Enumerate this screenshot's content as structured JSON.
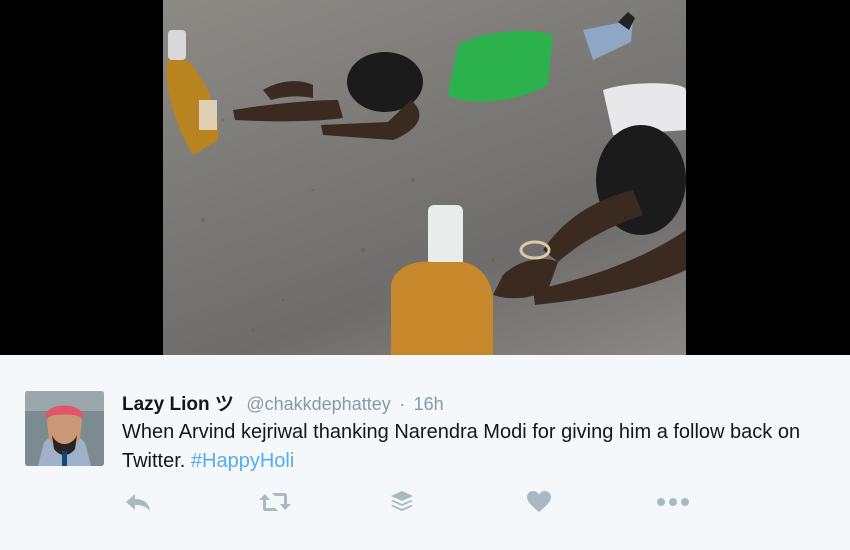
{
  "tweet": {
    "display_name": "Lazy Lion ツ",
    "handle": "@chakkdephattey",
    "separator": "·",
    "time": "16h",
    "text_main": "When Arvind kejriwal thanking Narendra Modi for giving him a follow back on Twitter. ",
    "hashtag": "#HappyHoli"
  },
  "actions": [
    {
      "name": "reply-icon"
    },
    {
      "name": "retweet-icon"
    },
    {
      "name": "buffer-icon"
    },
    {
      "name": "like-icon"
    },
    {
      "name": "more-icon"
    }
  ],
  "colors": {
    "background": "#f5f8fa",
    "text": "#14171a",
    "muted": "#8899a6",
    "link": "#55acee",
    "icon": "#aab8c2"
  }
}
